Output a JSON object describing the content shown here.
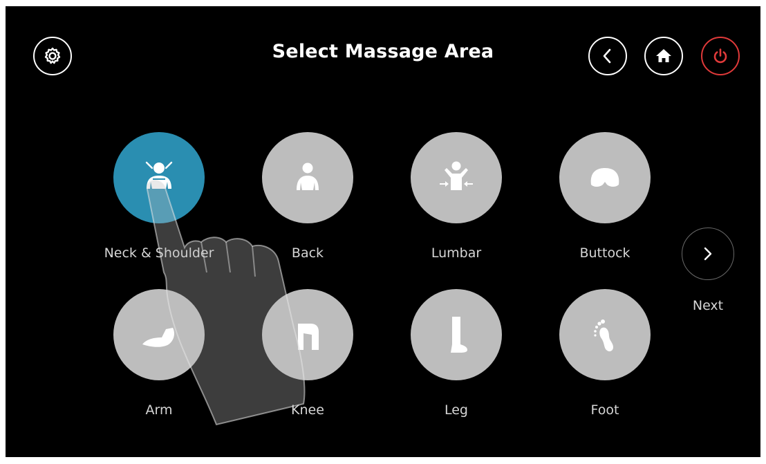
{
  "header": {
    "title": "Select Massage Area",
    "settings_icon": "gear-icon",
    "back_icon": "chevron-left-icon",
    "home_icon": "home-icon",
    "power_icon": "power-icon",
    "power_color": "#e03a3a"
  },
  "areas": [
    {
      "label": "Neck & Shoulder",
      "icon": "neck-shoulder-icon",
      "selected": true
    },
    {
      "label": "Back",
      "icon": "back-icon",
      "selected": false
    },
    {
      "label": "Lumbar",
      "icon": "lumbar-icon",
      "selected": false
    },
    {
      "label": "Buttock",
      "icon": "buttock-icon",
      "selected": false
    },
    {
      "label": "Arm",
      "icon": "arm-icon",
      "selected": false
    },
    {
      "label": "Knee",
      "icon": "knee-icon",
      "selected": false
    },
    {
      "label": "Leg",
      "icon": "leg-icon",
      "selected": false
    },
    {
      "label": "Foot",
      "icon": "foot-icon",
      "selected": false
    }
  ],
  "next": {
    "label": "Next",
    "icon": "chevron-right-icon"
  },
  "colors": {
    "background": "#000000",
    "selected": "#2a8eb1",
    "unselected": "#bdbdbd",
    "label": "#d6d6d6"
  }
}
